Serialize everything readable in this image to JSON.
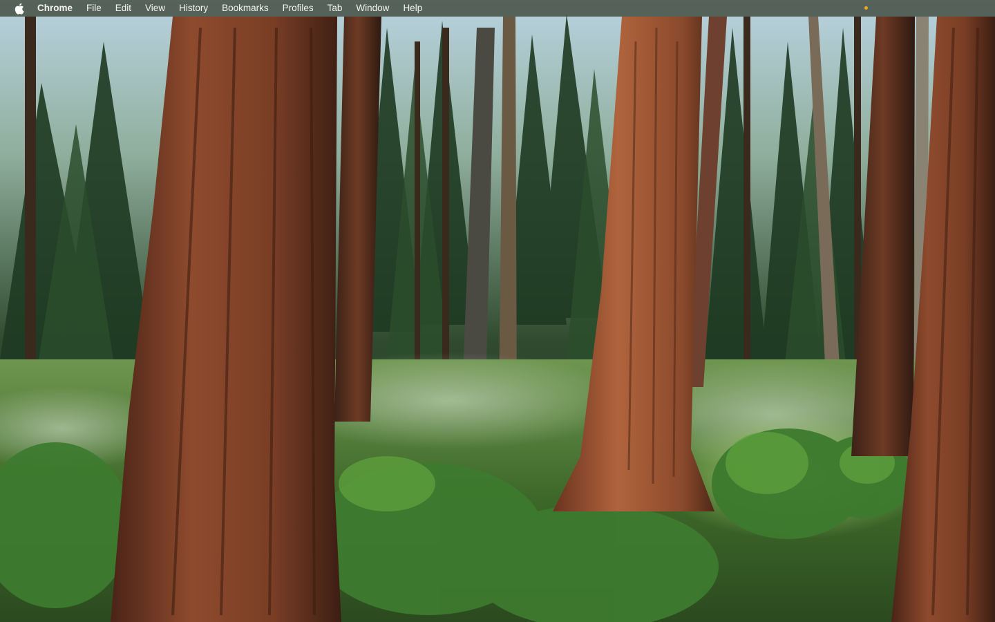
{
  "menubar": {
    "apple_icon": "apple-logo-icon",
    "app_name": "Chrome",
    "items": [
      "File",
      "Edit",
      "View",
      "History",
      "Bookmarks",
      "Profiles",
      "Tab",
      "Window",
      "Help"
    ],
    "status_indicator_color": "#f2a516"
  },
  "wallpaper": {
    "colors": {
      "trunk": "#8a4a2c",
      "foliage": "#274128",
      "sky": "#c8dce6",
      "undergrowth": "#5c8a3a"
    }
  }
}
